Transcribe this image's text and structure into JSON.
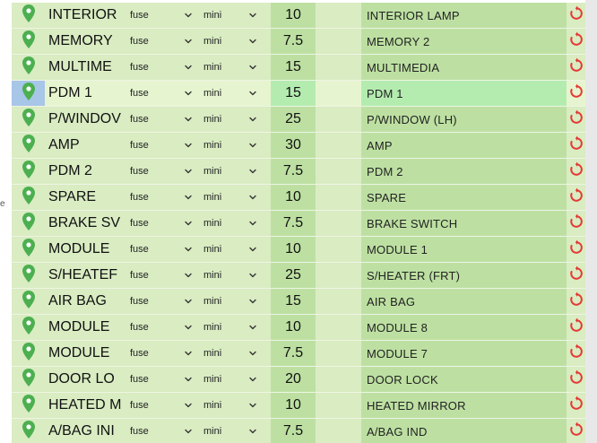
{
  "type_options_label": "fuse",
  "size_options_label": "mini",
  "left_scrap_text": "e",
  "colors": {
    "row_bg": "#d9ecc2",
    "column_bg": "#bde0a2",
    "selected_row_bg": "#e6f5cf",
    "selected_column_bg": "#b4ecb0",
    "selected_marker_bg": "#a7c6e8",
    "pin_green": "#4caf50",
    "reset_red": "#e53935"
  },
  "icons": {
    "location": "map-pin-icon",
    "select_arrow": "chevron-down-icon",
    "reset": "refresh-icon"
  },
  "rows": [
    {
      "name": "INTERIOR",
      "type": "fuse",
      "size": "mini",
      "amps": "10",
      "desc": "INTERIOR LAMP",
      "selected": false
    },
    {
      "name": "MEMORY",
      "type": "fuse",
      "size": "mini",
      "amps": "7.5",
      "desc": "MEMORY 2",
      "selected": false
    },
    {
      "name": "MULTIME",
      "type": "fuse",
      "size": "mini",
      "amps": "15",
      "desc": "MULTIMEDIA",
      "selected": false
    },
    {
      "name": "PDM 1",
      "type": "fuse",
      "size": "mini",
      "amps": "15",
      "desc": "PDM 1",
      "selected": true
    },
    {
      "name": "P/WINDOV",
      "type": "fuse",
      "size": "mini",
      "amps": "25",
      "desc": "P/WINDOW (LH)",
      "selected": false
    },
    {
      "name": "AMP",
      "type": "fuse",
      "size": "mini",
      "amps": "30",
      "desc": "AMP",
      "selected": false
    },
    {
      "name": "PDM 2",
      "type": "fuse",
      "size": "mini",
      "amps": "7.5",
      "desc": "PDM 2",
      "selected": false
    },
    {
      "name": "SPARE",
      "type": "fuse",
      "size": "mini",
      "amps": "10",
      "desc": "SPARE",
      "selected": false
    },
    {
      "name": "BRAKE SV",
      "type": "fuse",
      "size": "mini",
      "amps": "7.5",
      "desc": "BRAKE SWITCH",
      "selected": false
    },
    {
      "name": "MODULE",
      "type": "fuse",
      "size": "mini",
      "amps": "10",
      "desc": "MODULE 1",
      "selected": false
    },
    {
      "name": "S/HEATEF",
      "type": "fuse",
      "size": "mini",
      "amps": "25",
      "desc": "S/HEATER (FRT)",
      "selected": false
    },
    {
      "name": "AIR BAG",
      "type": "fuse",
      "size": "mini",
      "amps": "15",
      "desc": "AIR BAG",
      "selected": false
    },
    {
      "name": "MODULE",
      "type": "fuse",
      "size": "mini",
      "amps": "10",
      "desc": "MODULE 8",
      "selected": false
    },
    {
      "name": "MODULE",
      "type": "fuse",
      "size": "mini",
      "amps": "7.5",
      "desc": "MODULE 7",
      "selected": false
    },
    {
      "name": "DOOR LO",
      "type": "fuse",
      "size": "mini",
      "amps": "20",
      "desc": "DOOR LOCK",
      "selected": false
    },
    {
      "name": "HEATED M",
      "type": "fuse",
      "size": "mini",
      "amps": "10",
      "desc": "HEATED MIRROR",
      "selected": false
    },
    {
      "name": "A/BAG INI",
      "type": "fuse",
      "size": "mini",
      "amps": "7.5",
      "desc": "A/BAG IND",
      "selected": false
    }
  ]
}
